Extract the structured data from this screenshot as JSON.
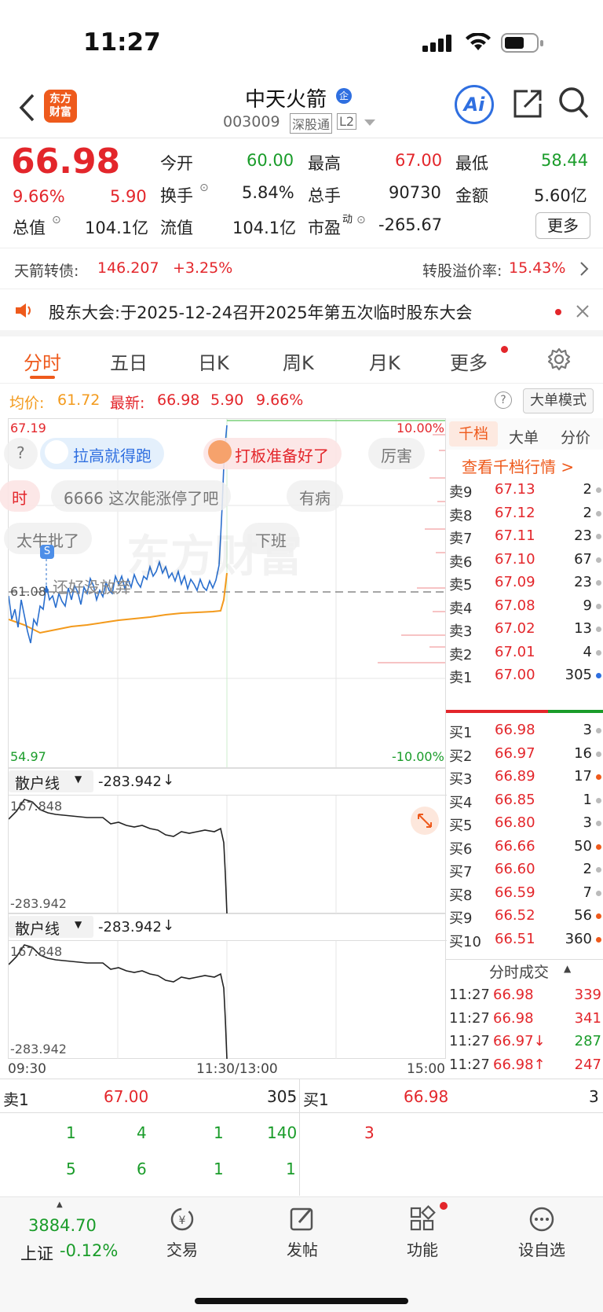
{
  "status": {
    "time": "11:27"
  },
  "header": {
    "logo_line1": "东方",
    "logo_line2": "财富",
    "name": "中天火箭",
    "badge": "企",
    "code": "003009",
    "tag1": "深股通",
    "tag2": "L2",
    "ai": "Ai"
  },
  "quote": {
    "price": "66.98",
    "pct": "9.66%",
    "chg": "5.90",
    "row1": [
      {
        "label": "今开",
        "value": "60.00"
      },
      {
        "label": "最高",
        "value": "67.00"
      },
      {
        "label": "最低",
        "value": "58.44"
      }
    ],
    "row2": [
      {
        "label": "换手",
        "value": "5.84%"
      },
      {
        "label": "总手",
        "value": "90730"
      },
      {
        "label": "金额",
        "value": "5.60亿"
      }
    ],
    "row3": [
      {
        "label": "总值",
        "value": "104.1亿"
      },
      {
        "label": "流值",
        "value": "104.1亿"
      },
      {
        "label": "市盈",
        "sup": "动",
        "value": "-265.67"
      }
    ],
    "more": "更多"
  },
  "bond": {
    "label": "天箭转债:",
    "value": "146.207",
    "pct": "+3.25%",
    "premium_label": "转股溢价率:",
    "premium": "15.43%"
  },
  "notice": {
    "text": "股东大会:于2025-12-24召开2025年第五次临时股东大会"
  },
  "tabs": [
    "分时",
    "五日",
    "日K",
    "周K",
    "月K",
    "更多"
  ],
  "avg": {
    "avg_label": "均价:",
    "avg": "61.72",
    "last_label": "最新:",
    "last": "66.98",
    "chg": "5.90",
    "pct": "9.66%",
    "mode": "大单模式"
  },
  "chart": {
    "high": "67.19",
    "low": "54.97",
    "high_pct": "10.00%",
    "low_pct": "-10.00%",
    "mid": "61.08",
    "time_start": "09:30",
    "time_mid": "11:30/13:00",
    "time_end": "15:00",
    "watermark": "东方财富"
  },
  "danmu": [
    "?",
    "拉高就得跑",
    "打板准备好了",
    "厉害",
    "时",
    "6666 这次能涨停了吧",
    "有病",
    "太牛批了",
    "下班",
    "还好没放弃"
  ],
  "sub": {
    "name": "散户线",
    "value": "-283.942",
    "top": "167.848",
    "bottom": "-283.942"
  },
  "book": {
    "tabs": [
      "千档",
      "大单",
      "分价"
    ],
    "link": "查看千档行情 >",
    "asks": [
      [
        "卖9",
        "67.13",
        "2"
      ],
      [
        "卖8",
        "67.12",
        "2"
      ],
      [
        "卖7",
        "67.11",
        "23"
      ],
      [
        "卖6",
        "67.10",
        "67"
      ],
      [
        "卖5",
        "67.09",
        "23"
      ],
      [
        "卖4",
        "67.08",
        "9"
      ],
      [
        "卖3",
        "67.02",
        "13"
      ],
      [
        "卖2",
        "67.01",
        "4"
      ],
      [
        "卖1",
        "67.00",
        "305"
      ]
    ],
    "bids": [
      [
        "买1",
        "66.98",
        "3"
      ],
      [
        "买2",
        "66.97",
        "16"
      ],
      [
        "买3",
        "66.89",
        "17"
      ],
      [
        "买4",
        "66.85",
        "1"
      ],
      [
        "买5",
        "66.80",
        "3"
      ],
      [
        "买6",
        "66.66",
        "50"
      ],
      [
        "买7",
        "66.60",
        "2"
      ],
      [
        "买8",
        "66.59",
        "7"
      ],
      [
        "买9",
        "66.52",
        "56"
      ],
      [
        "买10",
        "66.51",
        "360"
      ]
    ],
    "trades_label": "分时成交",
    "trades": [
      [
        "11:27",
        "66.98",
        "339"
      ],
      [
        "11:27",
        "66.98",
        "341"
      ],
      [
        "11:27",
        "66.97↓",
        "287"
      ],
      [
        "11:27",
        "66.98↑",
        "247"
      ]
    ]
  },
  "bottom": {
    "ask_label": "卖1",
    "ask_price": "67.00",
    "ask_vol": "305",
    "bid_label": "买1",
    "bid_price": "66.98",
    "bid_vol": "3",
    "ask_row1": [
      "1",
      "4",
      "1",
      "140"
    ],
    "ask_row2": [
      "5",
      "6",
      "1",
      "1"
    ],
    "bid_row1": [
      "3"
    ]
  },
  "nav": {
    "index_value": "3884.70",
    "index_name": "上证",
    "index_pct": "-0.12%",
    "items": [
      "交易",
      "发帖",
      "功能",
      "设自选"
    ]
  }
}
